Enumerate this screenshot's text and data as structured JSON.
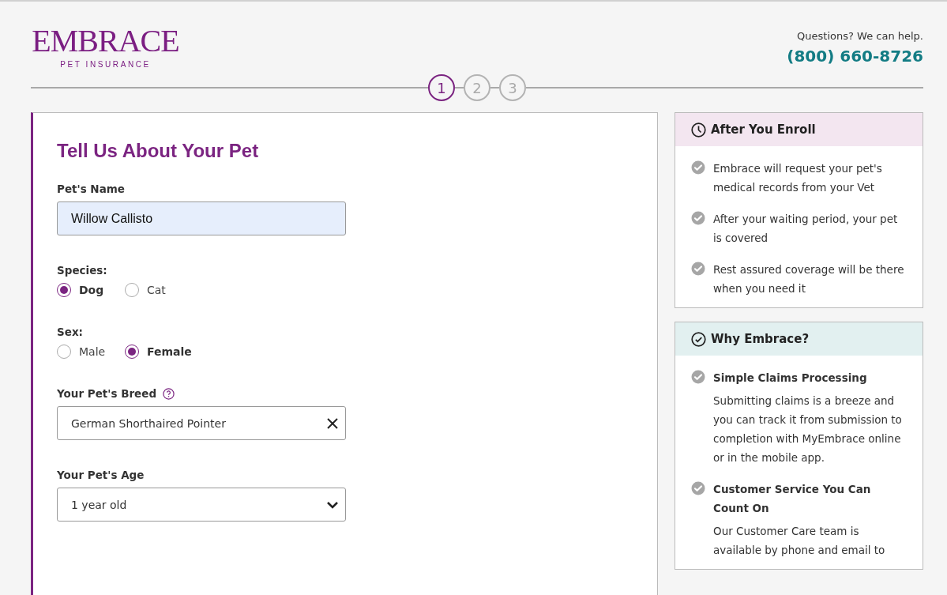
{
  "logo": {
    "wordmark": "EMBRACE",
    "tagline": "PET INSURANCE"
  },
  "contact": {
    "prompt": "Questions? We can help.",
    "phone": "(800) 660-8726"
  },
  "steps": [
    {
      "label": "1",
      "selected": true
    },
    {
      "label": "2",
      "selected": false
    },
    {
      "label": "3",
      "selected": false
    }
  ],
  "form": {
    "title": "Tell Us About Your Pet",
    "name_field": {
      "label": "Pet's Name",
      "value": "Willow Callisto"
    },
    "species": {
      "label": "Species:",
      "options": [
        {
          "label": "Dog",
          "selected": true
        },
        {
          "label": "Cat",
          "selected": false
        }
      ]
    },
    "sex": {
      "label": "Sex:",
      "options": [
        {
          "label": "Male",
          "selected": false
        },
        {
          "label": "Female",
          "selected": true
        }
      ]
    },
    "breed_field": {
      "label": "Your Pet's Breed",
      "value": "German Shorthaired Pointer"
    },
    "age_field": {
      "label": "Your Pet's Age",
      "value": "1 year old"
    }
  },
  "sidebar": [
    {
      "kind": "enroll",
      "title": "After You Enroll",
      "items": [
        {
          "text": "Embrace will request your pet's medical records from your Vet"
        },
        {
          "text": "After your waiting period, your pet is covered"
        },
        {
          "text": "Rest assured coverage will be there when you need it"
        }
      ]
    },
    {
      "kind": "why",
      "title": "Why Embrace?",
      "items": [
        {
          "title": "Simple Claims Processing",
          "text": "Submitting claims is a breeze and you can track it from submission to completion with MyEmbrace online or in the mobile app."
        },
        {
          "title": "Customer Service You Can Count On",
          "text": "Our Customer Care team is available by phone and email to"
        }
      ]
    }
  ]
}
